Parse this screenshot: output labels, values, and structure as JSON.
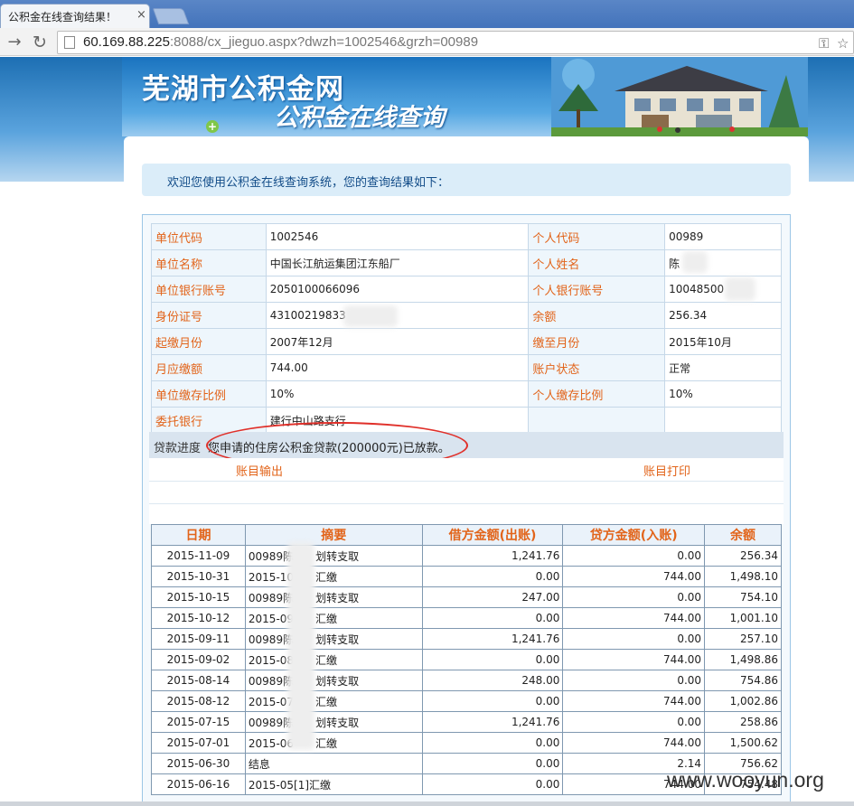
{
  "browser": {
    "tab_title": "公积金在线查询结果！",
    "tab_close": "×",
    "url_host": "60.169.88.225",
    "url_rest": ":8088/cx_jieguo.aspx?dwzh=1002546&grzh=00989",
    "icons": [
      "back-arrow-icon",
      "forward-arrow-icon",
      "reload-icon",
      "page-icon",
      "wrench-icon",
      "star-icon"
    ]
  },
  "banner": {
    "title_line1": "芜湖市公积金网",
    "title_line2": "公积金在线查询"
  },
  "welcome": "欢迎您使用公积金在线查询系统，您的查询结果如下：",
  "info": {
    "rows": [
      {
        "l1": "单位代码",
        "v1": "1002546",
        "l2": "个人代码",
        "v2": "00989"
      },
      {
        "l1": "单位名称",
        "v1": "中国长江航运集团江东船厂",
        "l2": "个人姓名",
        "v2": "陈"
      },
      {
        "l1": "单位银行账号",
        "v1": "2050100066096",
        "l2": "个人银行账号",
        "v2": "10048500"
      },
      {
        "l1": "身份证号",
        "v1": "43100219833",
        "l2": "余额",
        "v2": "256.34"
      },
      {
        "l1": "起缴月份",
        "v1": "2007年12月",
        "l2": "缴至月份",
        "v2": "2015年10月"
      },
      {
        "l1": "月应缴额",
        "v1": "744.00",
        "l2": "账户状态",
        "v2": "正常"
      },
      {
        "l1": "单位缴存比例",
        "v1": "10%",
        "l2": "个人缴存比例",
        "v2": "10%"
      },
      {
        "l1": "委托银行",
        "v1": "建行中山路支行",
        "l2": "",
        "v2": ""
      }
    ]
  },
  "loan": {
    "label": "贷款进度",
    "value": "您申请的住房公积金贷款(200000元)已放款。"
  },
  "actions": {
    "export": "账目输出",
    "print": "账目打印"
  },
  "ledger": {
    "headers": [
      "日期",
      "摘要",
      "借方金额(出账)",
      "贷方金额(入账)",
      "余额"
    ],
    "rows": [
      [
        "2015-11-09",
        "00989陈　　划转支取",
        "1,241.76",
        "0.00",
        "256.34"
      ],
      [
        "2015-10-31",
        "2015-10　　汇缴",
        "0.00",
        "744.00",
        "1,498.10"
      ],
      [
        "2015-10-15",
        "00989陈　　划转支取",
        "247.00",
        "0.00",
        "754.10"
      ],
      [
        "2015-10-12",
        "2015-09　　汇缴",
        "0.00",
        "744.00",
        "1,001.10"
      ],
      [
        "2015-09-11",
        "00989陈　　划转支取",
        "1,241.76",
        "0.00",
        "257.10"
      ],
      [
        "2015-09-02",
        "2015-08　　汇缴",
        "0.00",
        "744.00",
        "1,498.86"
      ],
      [
        "2015-08-14",
        "00989陈　　划转支取",
        "248.00",
        "0.00",
        "754.86"
      ],
      [
        "2015-08-12",
        "2015-07　　汇缴",
        "0.00",
        "744.00",
        "1,002.86"
      ],
      [
        "2015-07-15",
        "00989陈　　划转支取",
        "1,241.76",
        "0.00",
        "258.86"
      ],
      [
        "2015-07-01",
        "2015-06　　汇缴",
        "0.00",
        "744.00",
        "1,500.62"
      ],
      [
        "2015-06-30",
        "结息",
        "0.00",
        "2.14",
        "756.62"
      ],
      [
        "2015-06-16",
        "2015-05[1]汇缴",
        "0.00",
        "744.00",
        "754.48"
      ]
    ]
  },
  "watermark": "www.wooyun.org"
}
